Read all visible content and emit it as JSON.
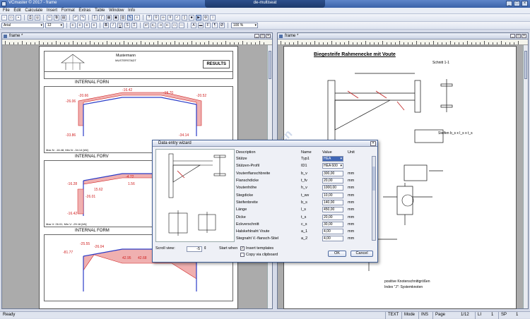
{
  "window": {
    "app_title": "VCmaster © 2017 - frame",
    "doc_title": "de-multiseat"
  },
  "menu": [
    "File",
    "Edit",
    "Calculate",
    "Insert",
    "Format",
    "Extras",
    "Table",
    "Window",
    "Info"
  ],
  "format_bar": {
    "font": "Arial",
    "size": "12",
    "zoom": "100 %"
  },
  "left_pane": {
    "title": "frame *",
    "header": {
      "company": "Mustermann",
      "street": "MUSTERSTADT",
      "results": "RESULTS"
    },
    "sections": [
      {
        "title": "INTERNAL FORN",
        "maxmin": "Max N: -16.48, Min N: -34.14 [kN]"
      },
      {
        "title": "INTERNAL FORV",
        "maxmin": "Max V: 26.01, Min V: -25.16 [kN]"
      },
      {
        "title": "INTERNAL FORM",
        "maxmin": ""
      }
    ],
    "labels_n": [
      "-20.66",
      "-16.42",
      "-19.70",
      "-20.52",
      "-26.06",
      "-33.86",
      "-34.14"
    ],
    "labels_v": [
      "-16.28",
      "-4.72",
      "15.62",
      "-26.01",
      "1.56",
      "-16.42"
    ],
    "labels_m": [
      "-25.55",
      "-26.04",
      "-81.77",
      "42.95",
      "42.68"
    ]
  },
  "right_pane": {
    "title": "frame *",
    "heading": "Biegesteife Rahmenecke mit Voute",
    "section_label": "Schnitt 1-1",
    "stiffener_label": "Steifen b_s x l_s x t_s",
    "notes": [
      "positive Knotenschnittgrößen",
      "Index \"J\": Systemknoten"
    ]
  },
  "dialog": {
    "title": "Data entry wizard",
    "columns": {
      "description": "Description",
      "name": "Name",
      "value": "Value",
      "unit": "Unit"
    },
    "rows": [
      {
        "description": "Stütze",
        "name": "Typ1",
        "value": "HEA",
        "unit": "",
        "select": true,
        "highlight": true
      },
      {
        "description": "Stützen-Profil",
        "name": "ID1",
        "value": "HEA 600",
        "unit": "",
        "select": true
      },
      {
        "description": "Voutenflanschbreite",
        "name": "b_v",
        "value": "300,00",
        "unit": "mm"
      },
      {
        "description": "Flanschdicke",
        "name": "t_fv",
        "value": "20,00",
        "unit": "mm"
      },
      {
        "description": "Voutenhöhe",
        "name": "h_v",
        "value": "1000,00",
        "unit": "mm"
      },
      {
        "description": "Stegdicke",
        "name": "t_wv",
        "value": "10,00",
        "unit": "mm"
      },
      {
        "description": "Steifenbreite",
        "name": "b_s",
        "value": "140,00",
        "unit": "mm"
      },
      {
        "description": "Länge",
        "name": "l_s",
        "value": "450,00",
        "unit": "mm"
      },
      {
        "description": "Dicke",
        "name": "t_s",
        "value": "20,00",
        "unit": "mm"
      },
      {
        "description": "Eckverschnitt",
        "name": "c_s",
        "value": "30,00",
        "unit": "mm"
      },
      {
        "description": "Halskehlnaht Voute",
        "name": "a_1",
        "value": "4,00",
        "unit": "mm"
      },
      {
        "description": "Stegnaht V.-flansch-Stiel",
        "name": "a_2",
        "value": "4,00",
        "unit": "mm"
      }
    ],
    "scroll_view_label": "Scroll view:",
    "scroll_view_value": "-5",
    "start_when_label": "Start when",
    "insert_templates": "Insert templates",
    "copy_clipboard": "Copy via clipboard",
    "ok": "OK",
    "cancel": "Cancel"
  },
  "status": {
    "ready": "Ready",
    "mode": "TEXT",
    "modify": "Mode",
    "ins": "INS",
    "page_label": "Page",
    "page": "1/12",
    "li_label": "LI",
    "li": "1",
    "sp_label": "SP",
    "sp": "1"
  },
  "watermark": "Vecn.cn",
  "colors": {
    "accent": "#3a62a8",
    "diagram_red": "#d02020",
    "diagram_blue": "#2a3cc8"
  }
}
